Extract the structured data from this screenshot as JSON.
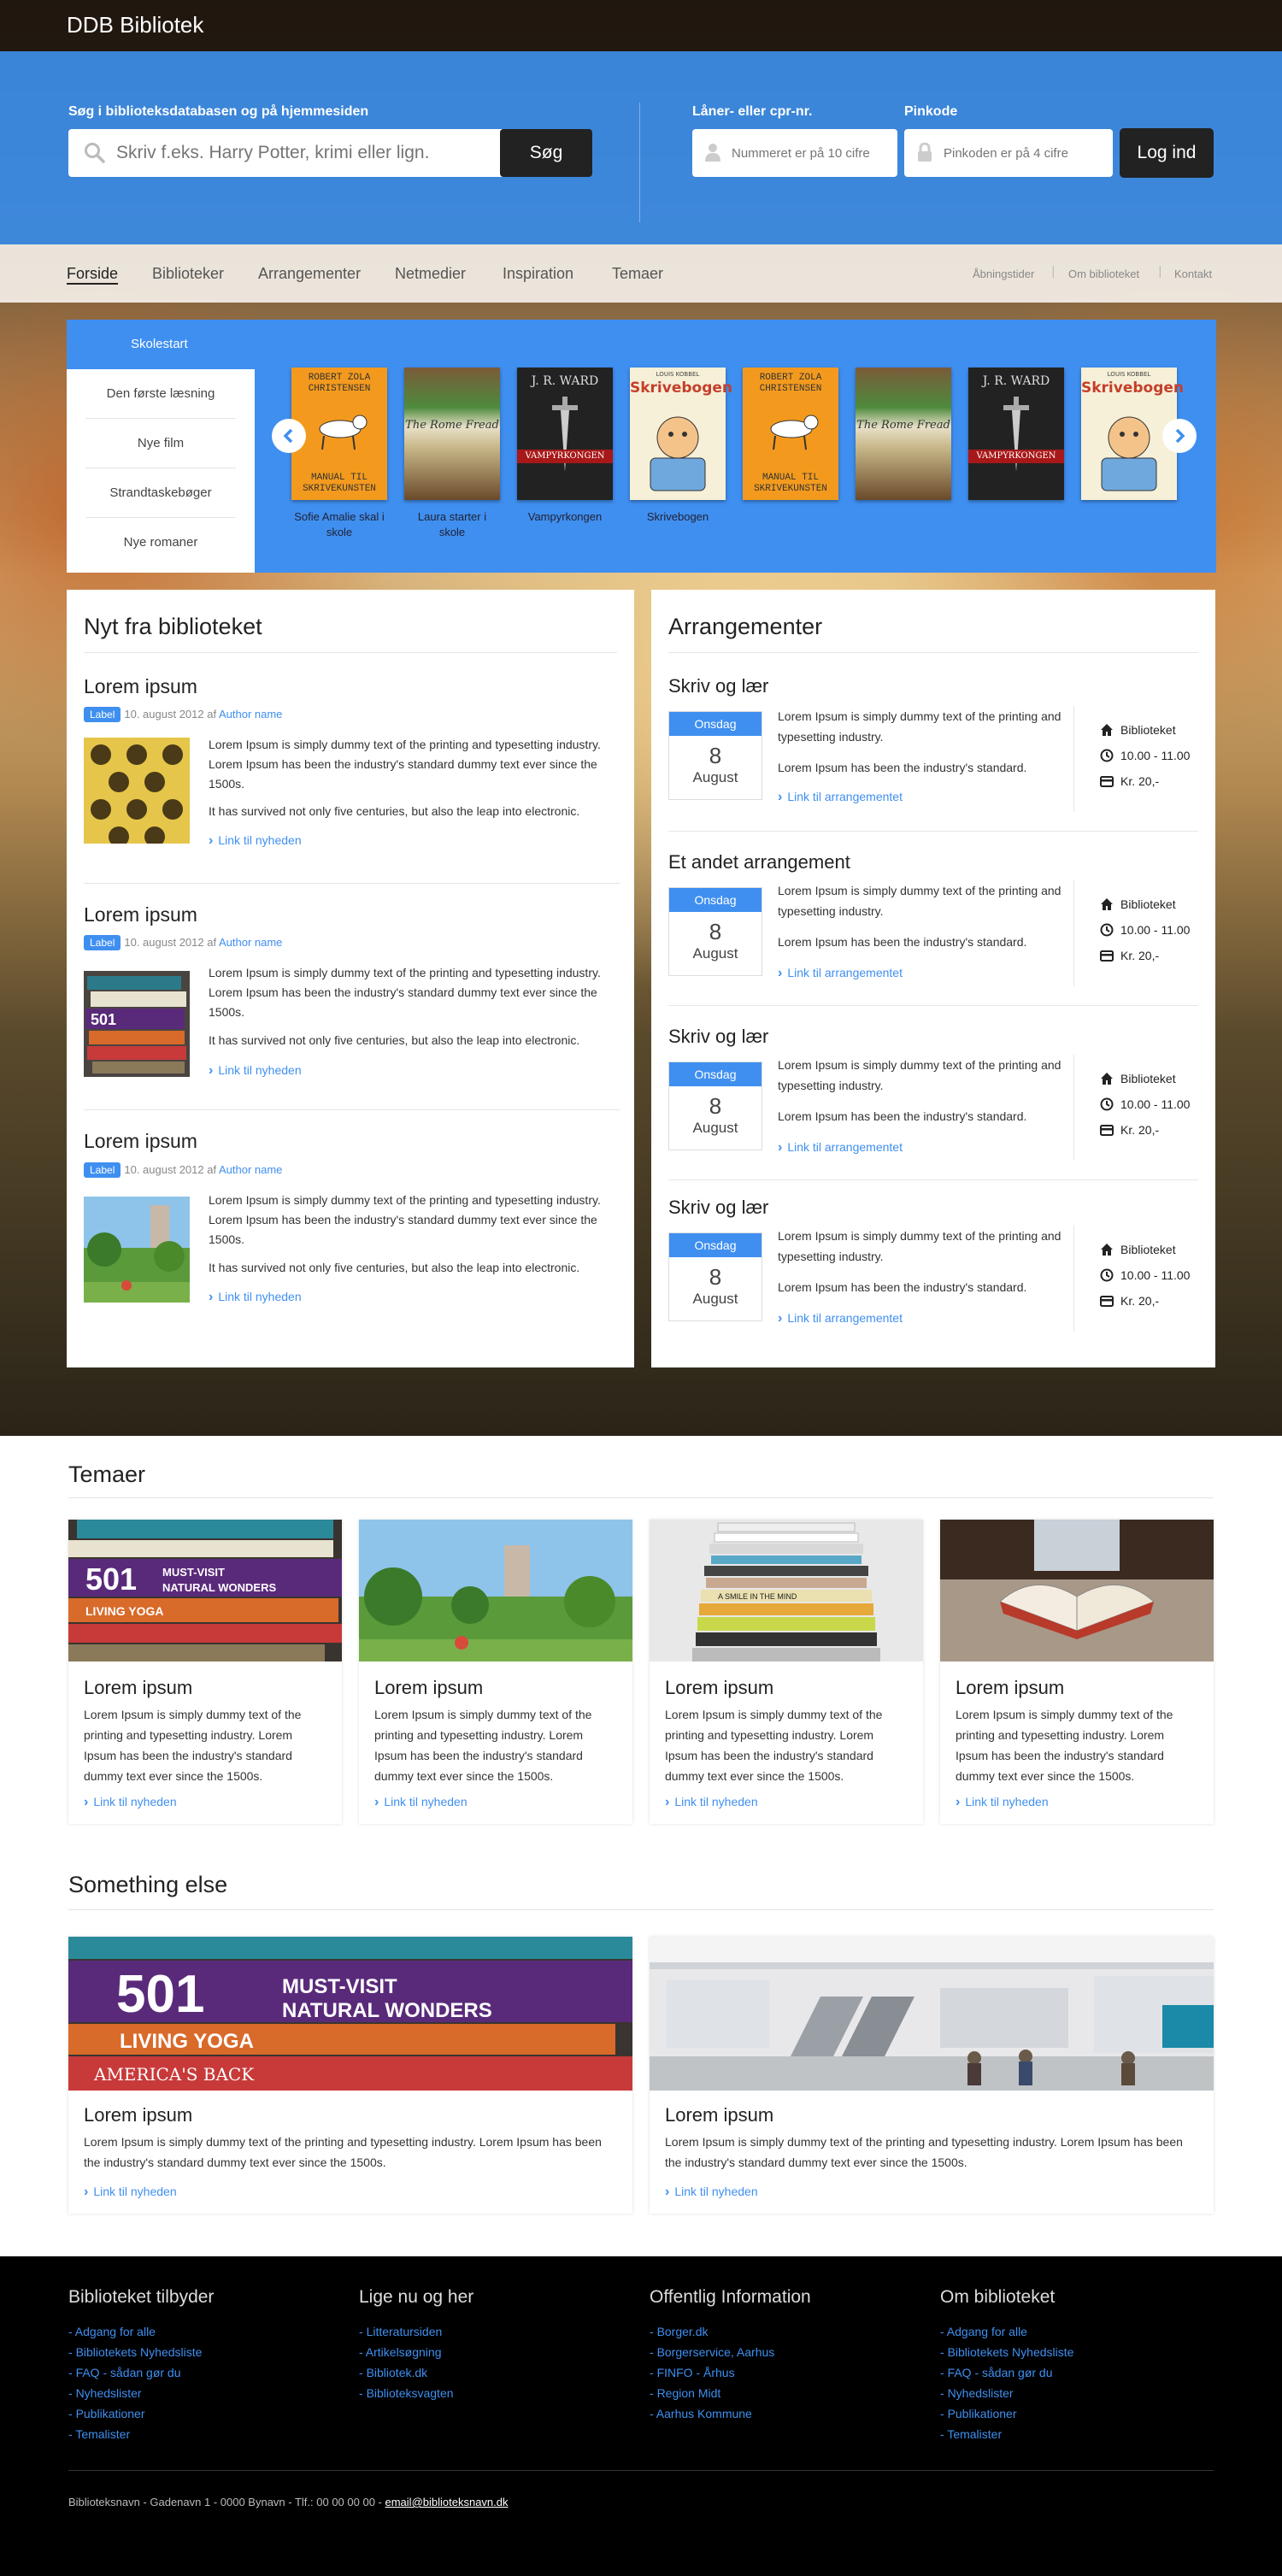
{
  "header": {
    "logo": "DDB Bibliotek"
  },
  "search": {
    "label": "Søg i biblioteksdatabasen og på hjemmesiden",
    "placeholder": "Skriv f.eks. Harry Potter, krimi eller lign.",
    "button": "Søg"
  },
  "login": {
    "cpr_label": "Låner- eller cpr-nr.",
    "cpr_placeholder": "Nummeret er på 10 cifre",
    "pin_label": "Pinkode",
    "pin_placeholder": "Pinkoden er på 4 cifre",
    "button": "Log ind"
  },
  "nav": {
    "items": [
      "Forside",
      "Biblioteker",
      "Arrangementer",
      "Netmedier",
      "Inspiration",
      "Temaer"
    ],
    "utility": [
      "Åbningstider",
      "Om biblioteket",
      "Kontakt"
    ]
  },
  "carousel": {
    "active_tab": "Skolestart",
    "categories": [
      "Den første læsning",
      "Nye film",
      "Strandtaskebøger",
      "Nye romaner"
    ],
    "captions": [
      "Sofie Amalie skal i skole",
      "Laura starter i skole",
      "Vampyrkongen",
      "Skrivebogen"
    ],
    "book_covers": [
      {
        "author": "ROBERT ZOLA CHRISTENSEN",
        "title": "MANUAL TIL SKRIVEKUNSTEN"
      },
      {
        "author": "",
        "title": "The Rome Fread"
      },
      {
        "author": "J. R. WARD",
        "title": "VAMPYRKONGEN"
      },
      {
        "author": "LOUIS KOBBEL",
        "title": "Skrivebogen"
      }
    ]
  },
  "news": {
    "title": "Nyt fra biblioteket",
    "items": [
      {
        "title": "Lorem ipsum",
        "label": "Label",
        "date": "10. august 2012 af",
        "author": "Author name",
        "text1": "Lorem Ipsum is simply dummy text of the printing and typesetting industry. Lorem Ipsum has been the industry's standard dummy text ever since the 1500s.",
        "text2": "It has survived not only five centuries, but also the leap into electronic.",
        "link": "Link til nyheden"
      },
      {
        "title": "Lorem ipsum",
        "label": "Label",
        "date": "10. august 2012 af",
        "author": "Author name",
        "text1": "Lorem Ipsum is simply dummy text of the printing and typesetting industry. Lorem Ipsum has been the industry's standard dummy text ever since the 1500s.",
        "text2": "It has survived not only five centuries, but also the leap into electronic.",
        "link": "Link til nyheden"
      },
      {
        "title": "Lorem ipsum",
        "label": "Label",
        "date": "10. august 2012 af",
        "author": "Author name",
        "text1": "Lorem Ipsum is simply dummy text of the printing and typesetting industry. Lorem Ipsum has been the industry's standard dummy text ever since the 1500s.",
        "text2": "It has survived not only five centuries, but also the leap into electronic.",
        "link": "Link til nyheden"
      }
    ]
  },
  "events": {
    "title": "Arrangementer",
    "items": [
      {
        "title": "Skriv og lær",
        "weekday": "Onsdag",
        "day": "8",
        "month": "August",
        "text1": "Lorem Ipsum is simply dummy text of the printing and typesetting industry.",
        "text2": "Lorem Ipsum has been the industry's standard.",
        "link": "Link til arrangementet",
        "place": "Biblioteket",
        "time": "10.00 - 11.00",
        "price": "Kr. 20,-"
      },
      {
        "title": "Et andet arrangement",
        "weekday": "Onsdag",
        "day": "8",
        "month": "August",
        "text1": "Lorem Ipsum is simply dummy text of the printing and typesetting industry.",
        "text2": "Lorem Ipsum has been the industry's standard.",
        "link": "Link til arrangementet",
        "place": "Biblioteket",
        "time": "10.00 - 11.00",
        "price": "Kr. 20,-"
      },
      {
        "title": "Skriv og lær",
        "weekday": "Onsdag",
        "day": "8",
        "month": "August",
        "text1": "Lorem Ipsum is simply dummy text of the printing and typesetting industry.",
        "text2": "Lorem Ipsum has been the industry's standard.",
        "link": "Link til arrangementet",
        "place": "Biblioteket",
        "time": "10.00 - 11.00",
        "price": "Kr. 20,-"
      },
      {
        "title": "Skriv og lær",
        "weekday": "Onsdag",
        "day": "8",
        "month": "August",
        "text1": "Lorem Ipsum is simply dummy text of the printing and typesetting industry.",
        "text2": "Lorem Ipsum has been the industry's standard.",
        "link": "Link til arrangementet",
        "place": "Biblioteket",
        "time": "10.00 - 11.00",
        "price": "Kr. 20,-"
      }
    ]
  },
  "themes": {
    "title": "Temaer",
    "cards": [
      {
        "title": "Lorem ipsum",
        "text": "Lorem Ipsum is simply dummy text of the printing and typesetting industry. Lorem Ipsum has been the industry's standard dummy text ever since the 1500s.",
        "link": "Link til nyheden"
      },
      {
        "title": "Lorem ipsum",
        "text": "Lorem Ipsum is simply dummy text of the printing and typesetting industry. Lorem Ipsum has been the industry's standard dummy text ever since the 1500s.",
        "link": "Link til nyheden"
      },
      {
        "title": "Lorem ipsum",
        "text": "Lorem Ipsum is simply dummy text of the printing and typesetting industry. Lorem Ipsum has been the industry's standard dummy text ever since the 1500s.",
        "link": "Link til nyheden"
      },
      {
        "title": "Lorem ipsum",
        "text": "Lorem Ipsum is simply dummy text of the printing and typesetting industry. Lorem Ipsum has been the industry's standard dummy text ever since the 1500s.",
        "link": "Link til nyheden"
      }
    ]
  },
  "something": {
    "title": "Something else",
    "cards": [
      {
        "title": "Lorem ipsum",
        "text": "Lorem Ipsum is simply dummy text of the printing and typesetting industry. Lorem Ipsum has been the industry's standard dummy text ever since the 1500s.",
        "link": "Link til nyheden"
      },
      {
        "title": "Lorem ipsum",
        "text": "Lorem Ipsum is simply dummy text of the printing and typesetting industry. Lorem Ipsum has been the industry's standard dummy text ever since the 1500s.",
        "link": "Link til nyheden"
      }
    ]
  },
  "book_spines": {
    "big_number": "501",
    "line1": "MUST-VISIT",
    "line2": "NATURAL WONDERS",
    "line3": "LIVING YOGA",
    "line4": "AMERICA'S BACK",
    "line5": "A SMILE IN THE MIND"
  },
  "footer": {
    "columns": [
      {
        "title": "Biblioteket tilbyder",
        "links": [
          "Adgang for alle",
          "Bibliotekets Nyhedsliste",
          "FAQ - sådan gør du",
          "Nyhedslister",
          "Publikationer",
          "Temalister"
        ]
      },
      {
        "title": "Lige nu og her",
        "links": [
          "Litteratursiden",
          "Artikelsøgning",
          "Bibliotek.dk",
          "Biblioteksvagten"
        ]
      },
      {
        "title": "Offentlig Information",
        "links": [
          "Borger.dk",
          "Borgerservice, Aarhus",
          "FINFO - Århus",
          "Region Midt",
          "Aarhus Kommune"
        ]
      },
      {
        "title": "Om biblioteket",
        "links": [
          "Adgang for alle",
          "Bibliotekets Nyhedsliste",
          "FAQ - sådan gør du",
          "Nyhedslister",
          "Publikationer",
          "Temalister"
        ]
      }
    ],
    "address": "Biblioteksnavn - Gadenavn 1 - 0000 Bynavn - Tlf.: 00 00 00 00 -",
    "email": "email@biblioteksnavn.dk"
  },
  "colors": {
    "accent": "#3f8ff0",
    "dark": "#222222",
    "footer": "#000000"
  }
}
